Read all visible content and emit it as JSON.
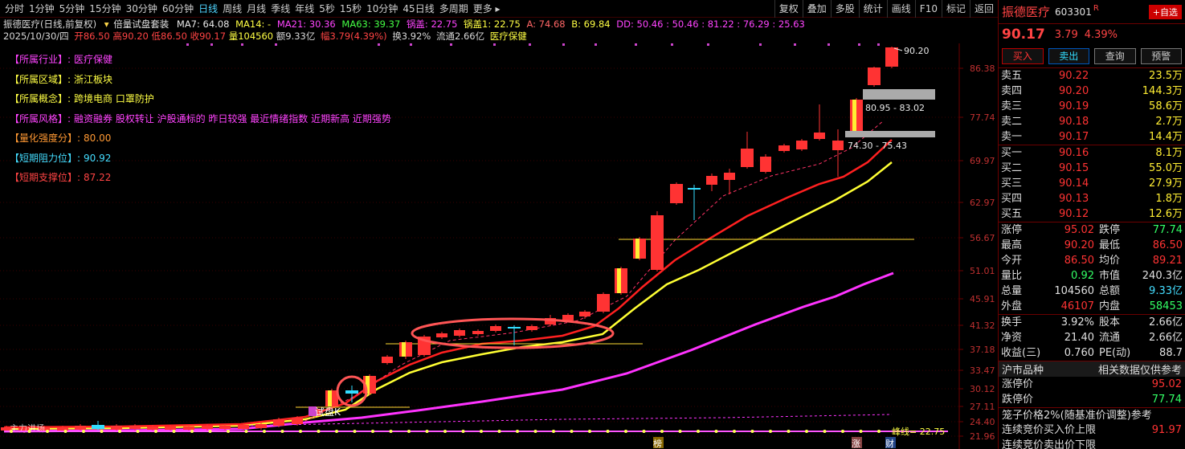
{
  "toolbar": {
    "timeframes": [
      "分时",
      "1分钟",
      "5分钟",
      "15分钟",
      "30分钟",
      "60分钟",
      "日线",
      "周线",
      "月线",
      "季线",
      "年线",
      "5秒",
      "15秒",
      "10分钟",
      "45日线",
      "多周期",
      "更多 ▸"
    ],
    "active_index": 6,
    "tools": [
      "复权",
      "叠加",
      "多股",
      "统计",
      "画线",
      "F10",
      "标记",
      "返回"
    ]
  },
  "info": {
    "title": "振德医疗(日线,前复权)",
    "indicator": "倍量试盘套装",
    "ma7": "MA7: 64.08",
    "ma14": "MA14: -",
    "ma21": "MA21: 30.36",
    "ma63": "MA63: 39.37",
    "guogai": "锅盖: 22.75",
    "guogai1": "锅盖1: 22.75",
    "a": "A: 74.68",
    "b": "B: 69.84",
    "dd": "DD: 50.46 : 50.46 : 81.22 : 76.29 : 25.63",
    "date": "2025/10/30/四",
    "open": "开86.50",
    "high": "高90.20",
    "low": "低86.50",
    "close": "收90.17",
    "vol": "量104560",
    "amount": "额9.33亿",
    "amp": "幅3.79(4.39%)",
    "turnover": "换3.92%",
    "float": "流通2.66亿",
    "sector": "医疗保健"
  },
  "tags": [
    {
      "label": "【所属行业】:",
      "value": "医疗保健",
      "color": "#ff44ff",
      "vcolor": "#ff44ff"
    },
    {
      "label": "【所属区域】:",
      "value": "浙江板块",
      "color": "#ffff44",
      "vcolor": "#ffff44"
    },
    {
      "label": "【所属概念】:",
      "value": "跨境电商  口罩防护",
      "color": "#ffff44",
      "vcolor": "#ffff44"
    },
    {
      "label": "【所属风格】:",
      "value": "融资融券  股权转让  沪股通标的  昨日较强  最近情绪指数  近期新高  近期强势",
      "color": "#ff44ff",
      "vcolor": "#ff44ff"
    },
    {
      "label": "【量化强度分】:",
      "value": "80.00",
      "color": "#ff9933",
      "vcolor": "#ff9933"
    },
    {
      "label": "【短期阻力位】:",
      "value": "90.92",
      "color": "#44ddff",
      "vcolor": "#44ddff"
    },
    {
      "label": "【短期支撑位】:",
      "value": "87.22",
      "color": "#ff4444",
      "vcolor": "#ff4444"
    }
  ],
  "chart": {
    "price_labels": [
      "86.38",
      "77.74",
      "69.97",
      "62.97",
      "56.67",
      "51.01",
      "45.91",
      "41.32",
      "37.18",
      "33.47",
      "30.12",
      "27.11",
      "24.40",
      "21.96"
    ],
    "last_price_label": "90.20",
    "zone1_label": "80.95 - 83.02",
    "zone2_label": "74.30 - 75.43",
    "shipan_label": "试盘K",
    "fengxian_label": "峰线= 22.75",
    "bottom_marks": [
      "榜",
      "涨",
      "财"
    ],
    "left_bottom_text": "主力进场",
    "colors": {
      "up": "#ff3333",
      "down": "#33ddff",
      "ma_red": "#ff2020",
      "ma_yellow": "#ffff33",
      "ma_magenta": "#ff33ff",
      "grid": "#3a0000"
    }
  },
  "quote": {
    "name": "振德医疗",
    "code": "603301",
    "badge": "R",
    "add_btn": "+自选",
    "price": "90.17",
    "change": "3.79",
    "pct": "4.39%",
    "buttons": [
      "买入",
      "卖出",
      "查询",
      "预警"
    ],
    "asks": [
      {
        "label": "卖五",
        "price": "90.22",
        "vol": "23.5万"
      },
      {
        "label": "卖四",
        "price": "90.20",
        "vol": "144.3万"
      },
      {
        "label": "卖三",
        "price": "90.19",
        "vol": "58.6万"
      },
      {
        "label": "卖二",
        "price": "90.18",
        "vol": "2.7万"
      },
      {
        "label": "卖一",
        "price": "90.17",
        "vol": "14.4万"
      }
    ],
    "bids": [
      {
        "label": "买一",
        "price": "90.16",
        "vol": "8.1万"
      },
      {
        "label": "买二",
        "price": "90.15",
        "vol": "55.0万"
      },
      {
        "label": "买三",
        "price": "90.14",
        "vol": "27.9万"
      },
      {
        "label": "买四",
        "price": "90.13",
        "vol": "1.8万"
      },
      {
        "label": "买五",
        "price": "90.12",
        "vol": "12.6万"
      }
    ],
    "stats": [
      {
        "k1": "涨停",
        "v1": "95.02",
        "c1": "#ff3333",
        "k2": "跌停",
        "v2": "77.74",
        "c2": "#33ff66"
      },
      {
        "k1": "最高",
        "v1": "90.20",
        "c1": "#ff3333",
        "k2": "最低",
        "v2": "86.50",
        "c2": "#ff3333"
      },
      {
        "k1": "今开",
        "v1": "86.50",
        "c1": "#ff3333",
        "k2": "均价",
        "v2": "89.21",
        "c2": "#ff3333"
      },
      {
        "k1": "量比",
        "v1": "0.92",
        "c1": "#33ff66",
        "k2": "市值",
        "v2": "240.3亿",
        "c2": "#e0e0e0"
      },
      {
        "k1": "总量",
        "v1": "104560",
        "c1": "#e0e0e0",
        "k2": "总额",
        "v2": "9.33亿",
        "c2": "#44ddff"
      },
      {
        "k1": "外盘",
        "v1": "46107",
        "c1": "#ff3333",
        "k2": "内盘",
        "v2": "58453",
        "c2": "#33ff66"
      }
    ],
    "stats2": [
      {
        "k1": "换手",
        "v1": "3.92%",
        "k2": "股本",
        "v2": "2.66亿"
      },
      {
        "k1": "净资",
        "v1": "21.40",
        "k2": "流通",
        "v2": "2.66亿"
      },
      {
        "k1": "收益(三)",
        "v1": "0.760",
        "k2": "PE(动)",
        "v2": "88.7"
      }
    ],
    "market_label": "沪市品种",
    "market_info": "相关数据仅供参考",
    "limit_up_label": "涨停价",
    "limit_up": "95.02",
    "limit_down_label": "跌停价",
    "limit_down": "77.74",
    "cage": "笼子价格2%(随基准价调整)参考",
    "auction_buy_label": "连续竞价买入价上限",
    "auction_buy": "91.97",
    "auction_sell_label": "连续竞价卖出价下限"
  }
}
